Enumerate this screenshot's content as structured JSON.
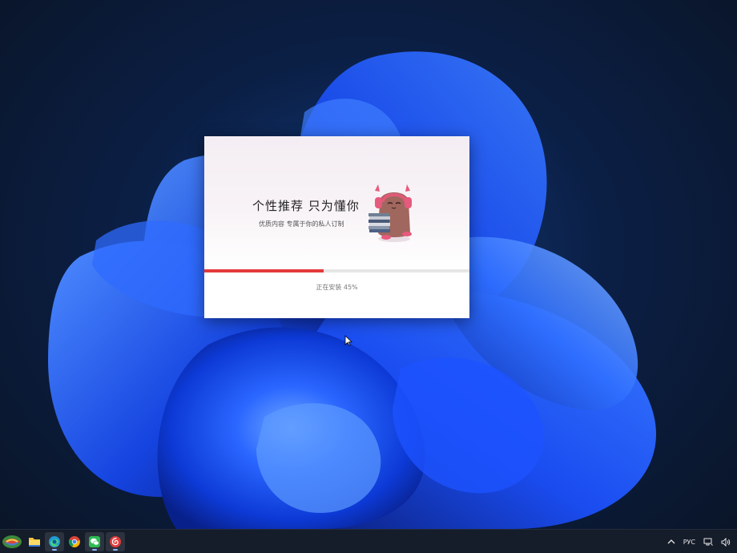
{
  "installer": {
    "title": "个性推荐 只为懂你",
    "subtitle": "优质内容 专属于你的私人订制",
    "progress_percent": 45,
    "status_text": "正在安装 45%",
    "accent_color": "#e33a3a"
  },
  "taskbar": {
    "apps": [
      {
        "name": "start-menu-icon",
        "active": false
      },
      {
        "name": "file-explorer-icon",
        "active": false
      },
      {
        "name": "edge-browser-icon",
        "active": true
      },
      {
        "name": "chrome-browser-icon",
        "active": false
      },
      {
        "name": "wechat-icon",
        "active": true
      },
      {
        "name": "netease-music-icon",
        "active": true
      }
    ],
    "tray": {
      "language": "РУС"
    }
  }
}
